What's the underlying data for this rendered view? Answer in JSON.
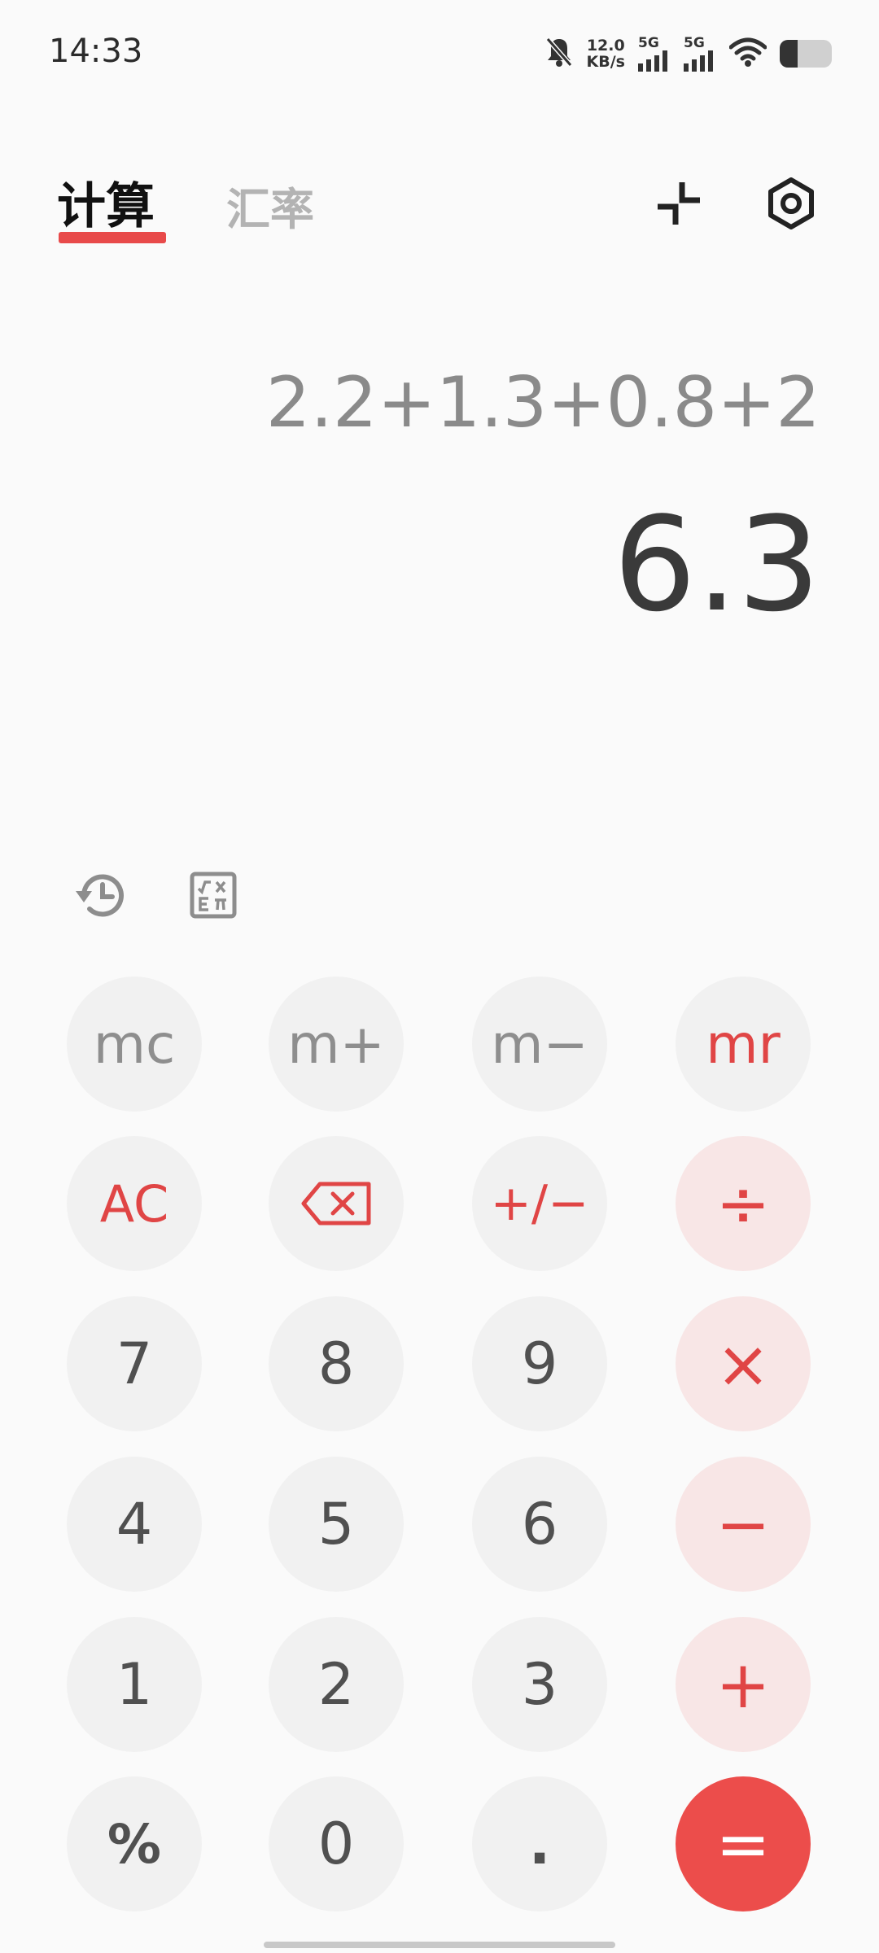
{
  "status_bar": {
    "time": "14:33",
    "net_speed_value": "12.0",
    "net_speed_unit": "KB/s",
    "sim1_label": "5G",
    "sim2_label": "5G",
    "battery_level": 0.35,
    "icons": [
      "bell-muted-icon",
      "signal-icon",
      "signal-icon",
      "wifi-icon",
      "battery-icon"
    ]
  },
  "tabs": [
    {
      "label": "计算",
      "active": true
    },
    {
      "label": "汇率",
      "active": false
    }
  ],
  "header_actions": [
    "shrink-icon",
    "settings-icon"
  ],
  "display": {
    "expression": "2.2+1.3+0.8+2",
    "result": "6.3"
  },
  "tools": [
    "history-icon",
    "scientific-icon"
  ],
  "keypad": {
    "mc": "mc",
    "m_plus": "m+",
    "m_minus": "m−",
    "mr": "mr",
    "ac": "AC",
    "backspace": "backspace-icon",
    "sign": "+/−",
    "divide": "÷",
    "seven": "7",
    "eight": "8",
    "nine": "9",
    "multiply": "×",
    "four": "4",
    "five": "5",
    "six": "6",
    "subtract": "−",
    "one": "1",
    "two": "2",
    "three": "3",
    "add": "+",
    "percent": "%",
    "zero": "0",
    "decimal": ".",
    "equals": "="
  },
  "colors": {
    "accent": "#E84A4A",
    "operator_bg": "#F8E6E6",
    "key_bg": "#F1F1F1",
    "background": "#FAFAFA"
  }
}
